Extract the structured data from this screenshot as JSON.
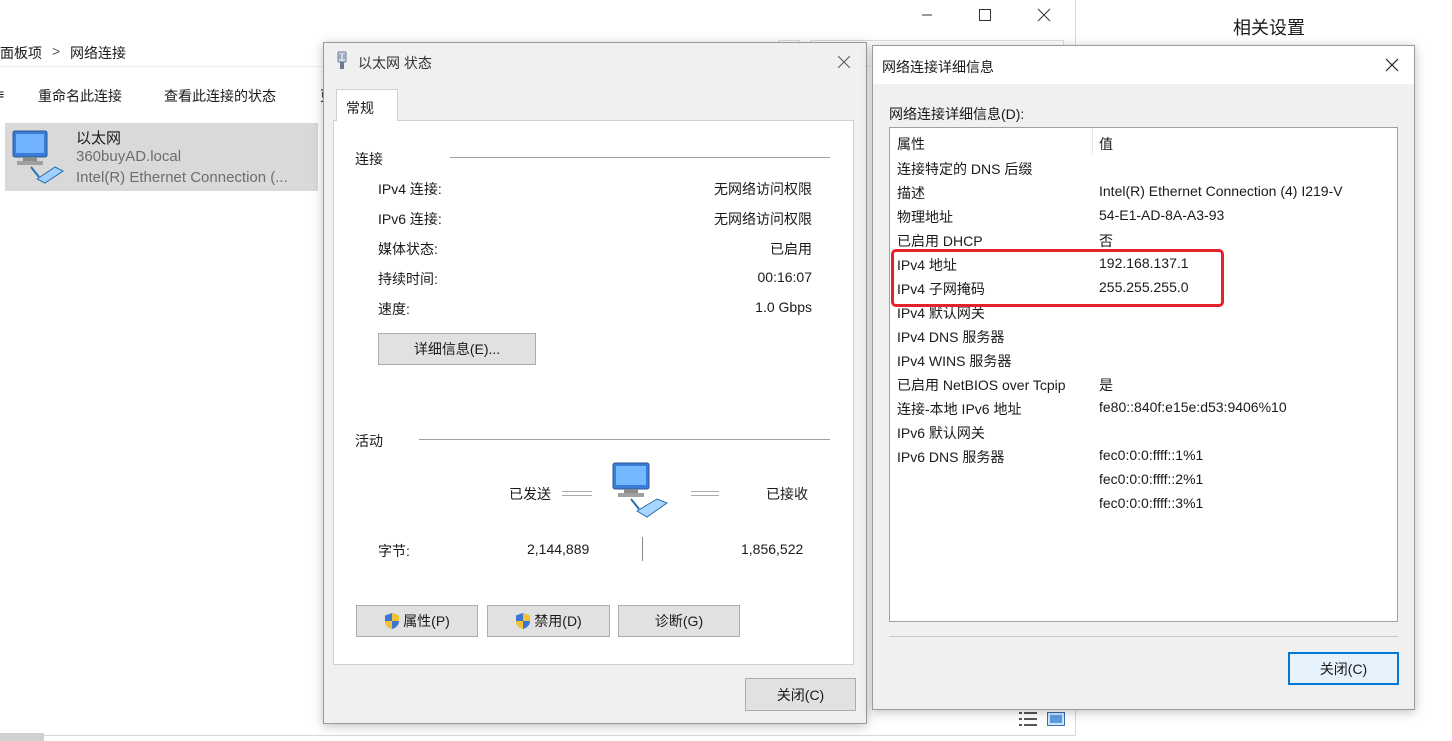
{
  "explorer": {
    "breadcrumb": {
      "parent": "面板项",
      "separator": ">",
      "current": "网络连接"
    },
    "commands": {
      "partial_left": "≡",
      "rename": "重命名此连接",
      "view_status": "查看此连接的状态",
      "partial_right": "更"
    },
    "adapter": {
      "name": "以太网",
      "domain": "360buyAD.local",
      "device": "Intel(R) Ethernet Connection (..."
    },
    "related_settings": "相关设置"
  },
  "status_dialog": {
    "title": "以太网 状态",
    "tab": "常规",
    "connection_section": "连接",
    "connection_rows": [
      {
        "key": "IPv4 连接:",
        "value": "无网络访问权限"
      },
      {
        "key": "IPv6 连接:",
        "value": "无网络访问权限"
      },
      {
        "key": "媒体状态:",
        "value": "已启用"
      },
      {
        "key": "持续时间:",
        "value": "00:16:07"
      },
      {
        "key": "速度:",
        "value": "1.0 Gbps"
      }
    ],
    "details_button": "详细信息(E)...",
    "activity_section": "活动",
    "sent_label": "已发送",
    "received_label": "已接收",
    "bytes_label": "字节:",
    "bytes_sent": "2,144,889",
    "bytes_received": "1,856,522",
    "properties_button": "属性(P)",
    "disable_button": "禁用(D)",
    "diagnose_button": "诊断(G)",
    "close_button": "关闭(C)"
  },
  "detail_dialog": {
    "title": "网络连接详细信息",
    "list_label": "网络连接详细信息(D):",
    "headers": {
      "property": "属性",
      "value": "值"
    },
    "rows": [
      {
        "property": "连接特定的 DNS 后缀",
        "value": ""
      },
      {
        "property": "描述",
        "value": "Intel(R) Ethernet Connection (4) I219-V"
      },
      {
        "property": "物理地址",
        "value": "54-E1-AD-8A-A3-93"
      },
      {
        "property": "已启用 DHCP",
        "value": "否"
      },
      {
        "property": "IPv4 地址",
        "value": "192.168.137.1"
      },
      {
        "property": "IPv4 子网掩码",
        "value": "255.255.255.0"
      },
      {
        "property": "IPv4 默认网关",
        "value": ""
      },
      {
        "property": "IPv4 DNS 服务器",
        "value": ""
      },
      {
        "property": "IPv4 WINS 服务器",
        "value": ""
      },
      {
        "property": "已启用 NetBIOS over Tcpip",
        "value": "是"
      },
      {
        "property": "连接-本地 IPv6 地址",
        "value": "fe80::840f:e15e:d53:9406%10"
      },
      {
        "property": "IPv6 默认网关",
        "value": ""
      },
      {
        "property": "IPv6 DNS 服务器",
        "value": "fec0:0:0:ffff::1%1"
      },
      {
        "property": "",
        "value": "fec0:0:0:ffff::2%1"
      },
      {
        "property": "",
        "value": "fec0:0:0:ffff::3%1"
      }
    ],
    "close_button": "关闭(C)"
  },
  "colors": {
    "highlight": "#e8202a",
    "accent": "#0078d7",
    "dialog_bg": "#f0f0f0",
    "selection": "#d9d9d9"
  },
  "icons": [
    "minimize-icon",
    "maximize-icon",
    "close-icon",
    "network-adapter-icon",
    "uac-shield-icon",
    "network-activity-icon"
  ]
}
